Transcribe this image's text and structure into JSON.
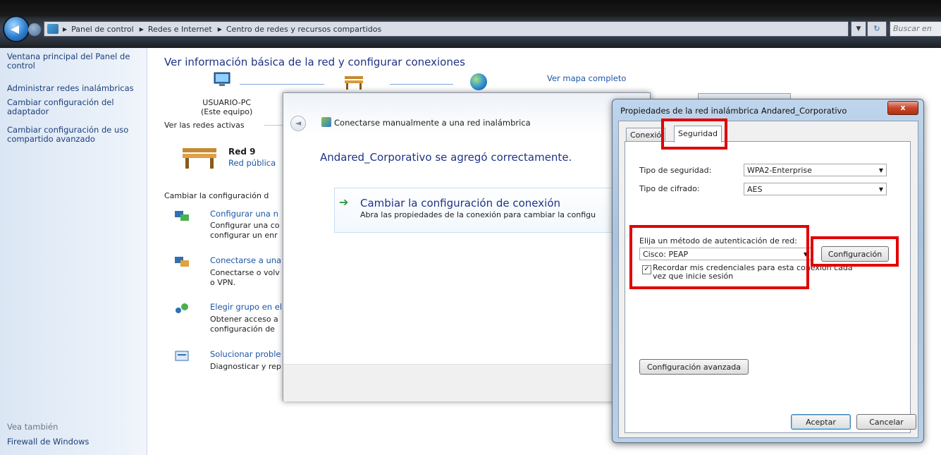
{
  "explorer": {
    "breadcrumbs": [
      "Panel de control",
      "Redes e Internet",
      "Centro de redes y recursos compartidos"
    ],
    "search_placeholder": "Buscar en",
    "refresh_glyph": "↻"
  },
  "sidebar": {
    "items": [
      {
        "label": "Ventana principal del Panel de control"
      },
      {
        "label": "Administrar redes inalámbricas"
      },
      {
        "label": "Cambiar configuración del adaptador"
      },
      {
        "label": "Cambiar configuración de uso compartido avanzado"
      }
    ],
    "see_also": "Vea también",
    "see_also_items": [
      "Firewall de Windows"
    ]
  },
  "main": {
    "title": "Ver información básica de la red y configurar conexiones",
    "map_link": "Ver mapa completo",
    "computer_name": "USUARIO-PC",
    "computer_note": "(Este equipo)",
    "active_networks": "Ver las redes activas",
    "network_name": "Red 9",
    "network_type": "Red pública",
    "change_config": "Cambiar la configuración d",
    "tasks": [
      {
        "title": "Configurar una n",
        "desc1": "Configurar una co",
        "desc2": "configurar un enr"
      },
      {
        "title": "Conectarse a una",
        "desc1": "Conectarse o volv",
        "desc2": "o VPN."
      },
      {
        "title": "Elegir grupo en el",
        "desc1": "Obtener acceso a",
        "desc2": "configuración de"
      },
      {
        "title": "Solucionar proble",
        "desc1": "Diagnosticar y rep",
        "desc2": ""
      }
    ]
  },
  "wizard": {
    "title": "Conectarse manualmente a una red inalámbrica",
    "message": "Andared_Corporativo se agregó correctamente.",
    "command_title": "Cambiar la configuración de conexión",
    "command_desc": "Abra las propiedades de la conexión para cambiar la configu",
    "back_glyph": "◄",
    "arrow_glyph": "➔"
  },
  "properties": {
    "title": "Propiedades de la red inalámbrica Andared_Corporativo",
    "close_glyph": "x",
    "tabs": [
      {
        "label": "Conexió"
      },
      {
        "label": "Seguridad"
      }
    ],
    "security_type_label": "Tipo de seguridad:",
    "security_type_value": "WPA2-Enterprise",
    "cipher_label": "Tipo de cifrado:",
    "cipher_value": "AES",
    "auth_label": "Elija un método de autenticación de red:",
    "auth_value": "Cisco: PEAP",
    "settings_button": "Configuración",
    "remember_label_1": "Recordar mis credenciales para esta conexión cada",
    "remember_label_2": "vez que inicie sesión",
    "remember_checked": "✓",
    "advanced_button": "Configuración avanzada",
    "ok_button": "Aceptar",
    "cancel_button": "Cancelar"
  }
}
